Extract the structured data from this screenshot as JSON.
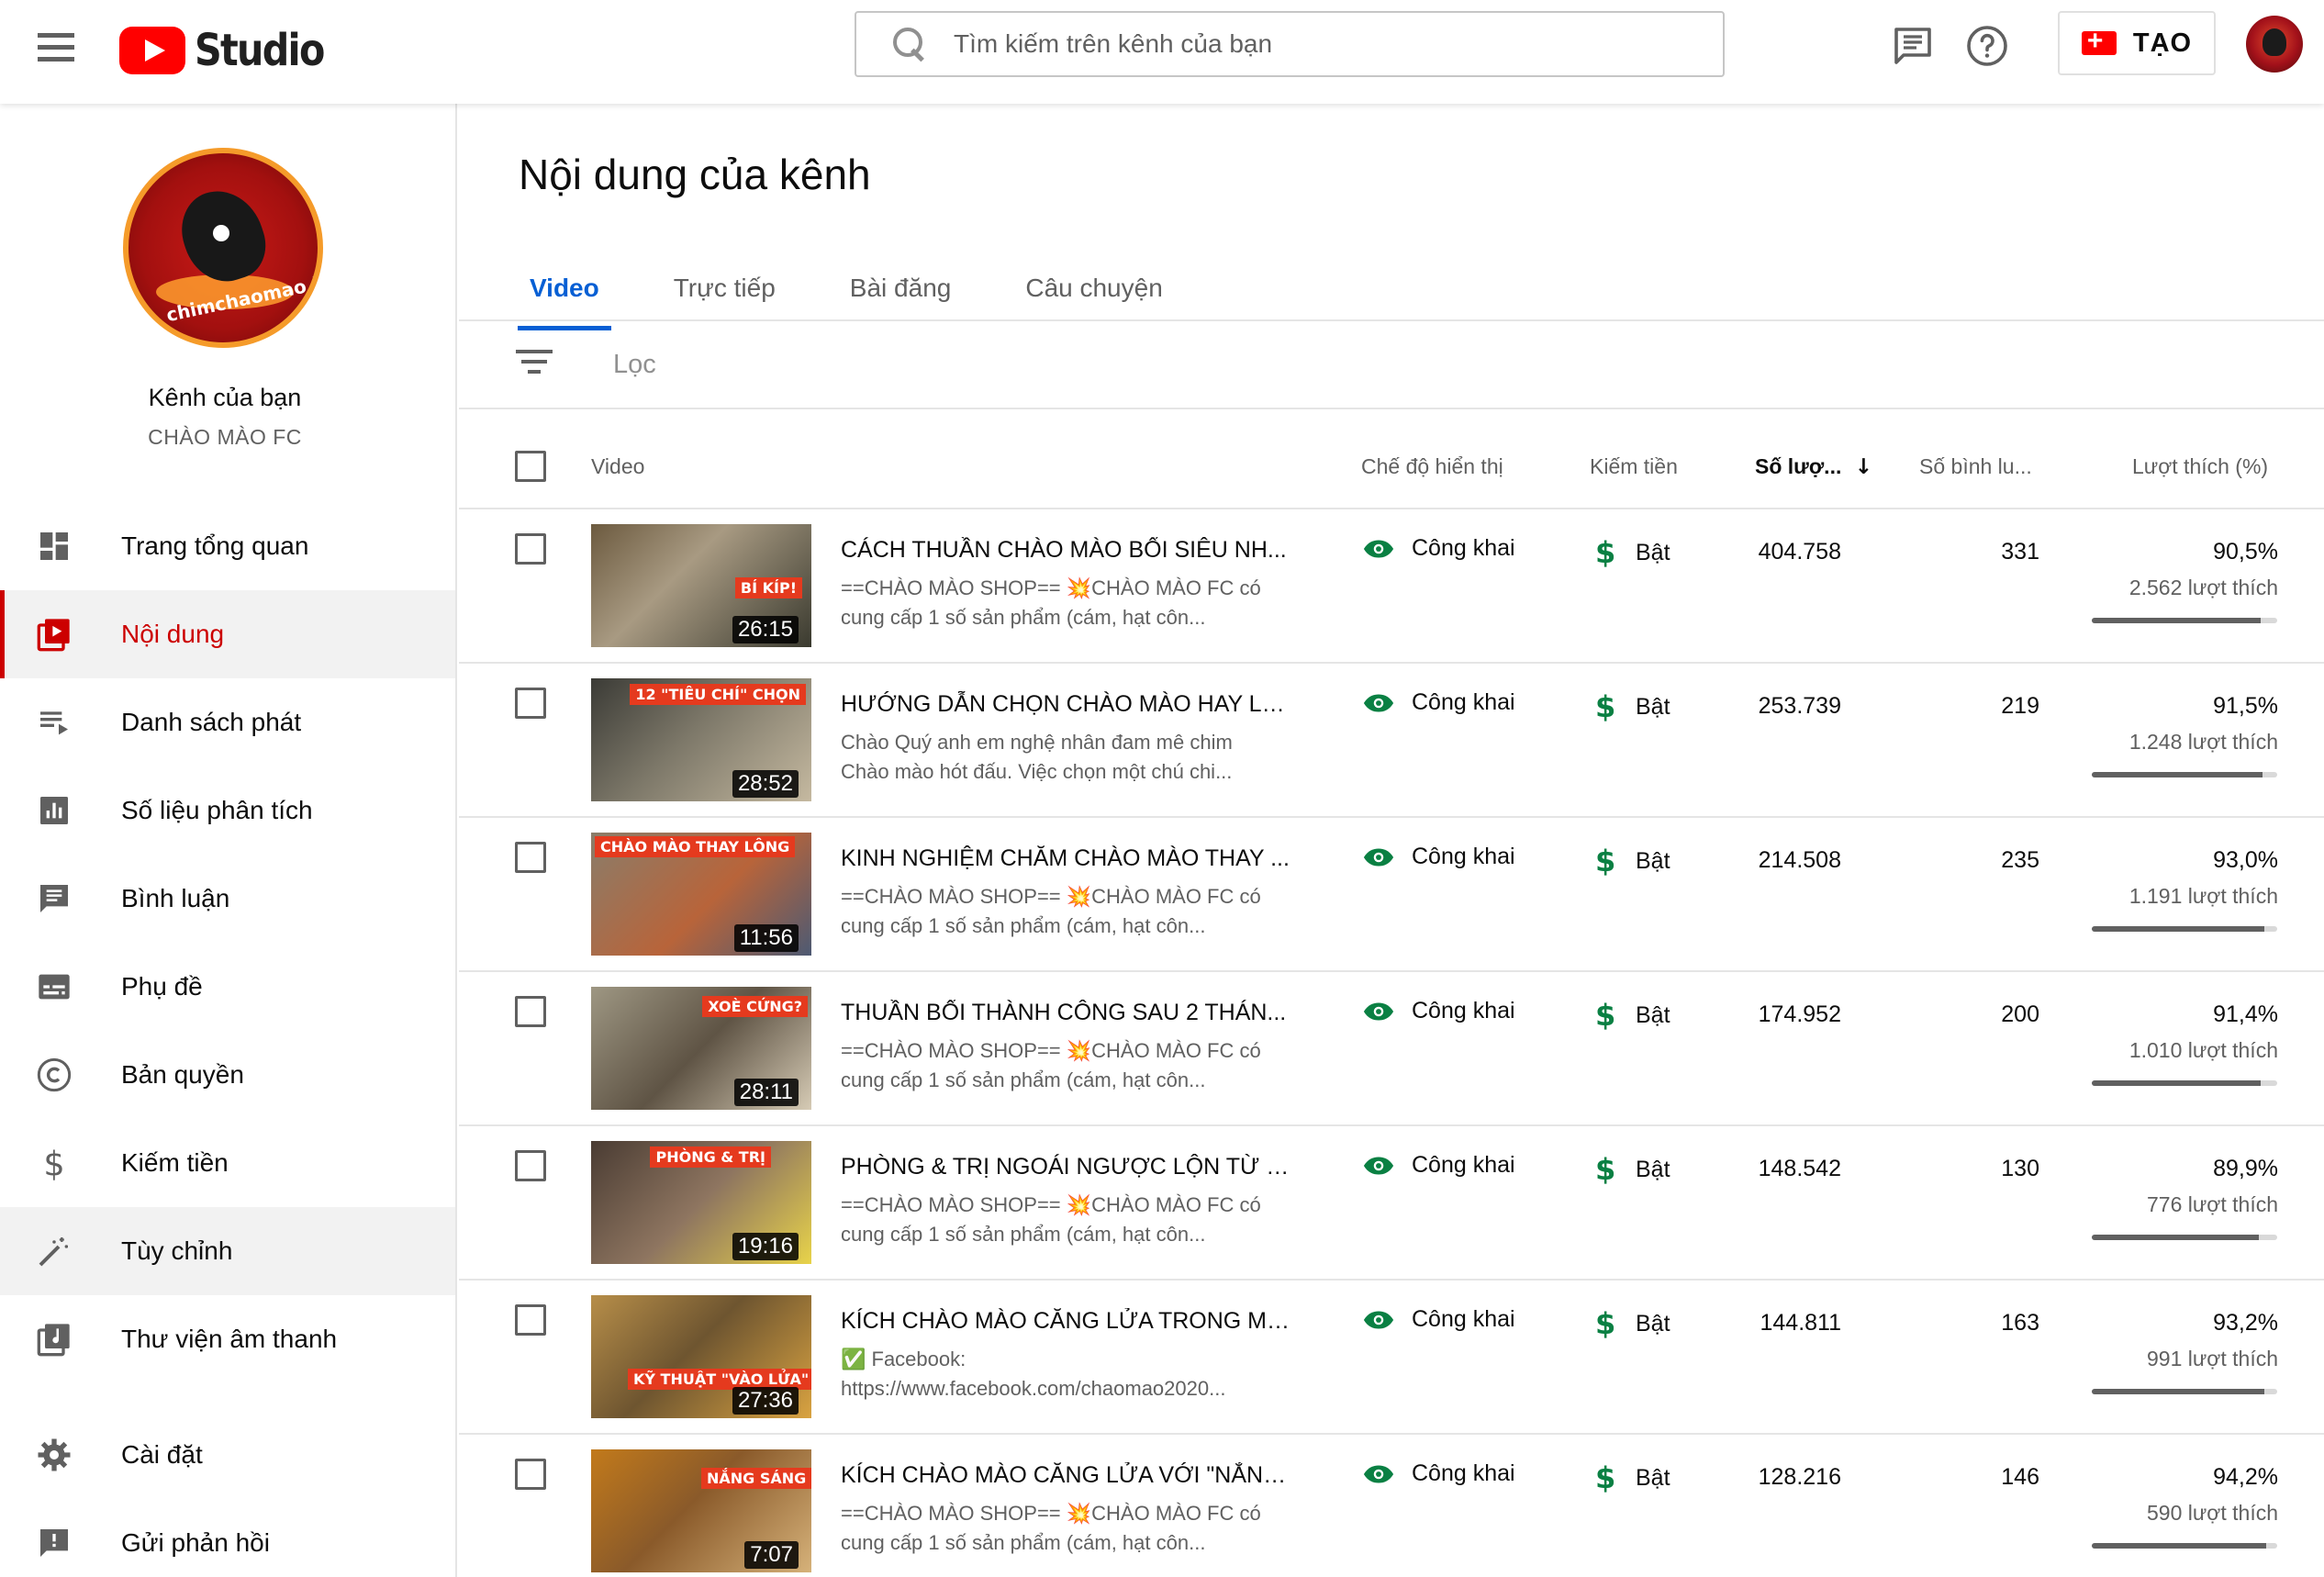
{
  "header": {
    "logo_text": "Studio",
    "search_placeholder": "Tìm kiếm trên kênh của bạn",
    "create_label": "TẠO",
    "icons": [
      "menu-icon",
      "feedback-icon",
      "help-icon",
      "create-camera-icon",
      "account-avatar"
    ],
    "brand_color": "#ff0000"
  },
  "sidebar": {
    "channel_title": "Kênh của bạn",
    "channel_name": "CHÀO MÀO FC",
    "avatar_text": "chimchaomao.info",
    "items": [
      {
        "label": "Trang tổng quan",
        "icon": "dashboard-icon"
      },
      {
        "label": "Nội dung",
        "icon": "content-icon",
        "active": true
      },
      {
        "label": "Danh sách phát",
        "icon": "playlist-icon"
      },
      {
        "label": "Số liệu phân tích",
        "icon": "analytics-icon"
      },
      {
        "label": "Bình luận",
        "icon": "comments-icon"
      },
      {
        "label": "Phụ đề",
        "icon": "subtitles-icon"
      },
      {
        "label": "Bản quyền",
        "icon": "copyright-icon"
      },
      {
        "label": "Kiếm tiền",
        "icon": "monetization-icon"
      },
      {
        "label": "Tùy chỉnh",
        "icon": "customization-icon"
      },
      {
        "label": "Thư viện âm thanh",
        "icon": "audio-library-icon"
      },
      {
        "label": "Cài đặt",
        "icon": "settings-icon"
      },
      {
        "label": "Gửi phản hồi",
        "icon": "send-feedback-icon"
      }
    ],
    "active_color": "#cc0000"
  },
  "main": {
    "title": "Nội dung của kênh",
    "tabs": [
      {
        "label": "Video",
        "active": true
      },
      {
        "label": "Trực tiếp"
      },
      {
        "label": "Bài đăng"
      },
      {
        "label": "Câu chuyện"
      }
    ],
    "filter_label": "Lọc",
    "columns": {
      "video": "Video",
      "visibility": "Chế độ hiển thị",
      "monetization": "Kiếm tiền",
      "views": "Số lượ...",
      "comments": "Số bình lu...",
      "likes": "Lượt thích (%)"
    },
    "accent_color": "#065fd4",
    "videos": [
      {
        "title": "CÁCH THUẦN CHÀO MÀO BỔI SIÊU NH...",
        "desc1": "==CHÀO MÀO SHOP== 💥CHÀO MÀO FC có",
        "desc2": "cung cấp 1 số sản phẩm (cám, hạt côn...",
        "duration": "26:15",
        "thumb_caption": "BÍ KÍP!",
        "visibility": "Công khai",
        "monetization": "Bật",
        "views": "404.758",
        "comments": "331",
        "likes_pct": "90,5%",
        "likes_count": "2.562 lượt thích",
        "likes_ratio": 0.905
      },
      {
        "title": "HƯỚNG DẪN CHỌN CHÀO MÀO HAY LU...",
        "desc1": "Chào Quý anh em nghệ nhân đam mê chim",
        "desc2": "Chào mào hót đấu. Việc chọn một chú chi...",
        "duration": "28:52",
        "thumb_caption": "12 \"TIÊU CHÍ\" CHỌN",
        "visibility": "Công khai",
        "monetization": "Bật",
        "views": "253.739",
        "comments": "219",
        "likes_pct": "91,5%",
        "likes_count": "1.248 lượt thích",
        "likes_ratio": 0.915
      },
      {
        "title": "KINH NGHIỆM CHĂM CHÀO MÀO THAY ...",
        "desc1": "==CHÀO MÀO SHOP== 💥CHÀO MÀO FC có",
        "desc2": "cung cấp 1 số sản phẩm (cám, hạt côn...",
        "duration": "11:56",
        "thumb_caption": "CHÀO MÀO THAY LÔNG",
        "visibility": "Công khai",
        "monetization": "Bật",
        "views": "214.508",
        "comments": "235",
        "likes_pct": "93,0%",
        "likes_count": "1.191 lượt thích",
        "likes_ratio": 0.93
      },
      {
        "title": "THUẦN BỔI THÀNH CÔNG SAU 2 THÁN...",
        "desc1": "==CHÀO MÀO SHOP== 💥CHÀO MÀO FC có",
        "desc2": "cung cấp 1 số sản phẩm (cám, hạt côn...",
        "duration": "28:11",
        "thumb_caption": "XOÈ CỨNG?",
        "visibility": "Công khai",
        "monetization": "Bật",
        "views": "174.952",
        "comments": "200",
        "likes_pct": "91,4%",
        "likes_count": "1.010 lượt thích",
        "likes_ratio": 0.914
      },
      {
        "title": "PHÒNG & TRỊ NGOÁI NGƯỢC LỘN TỪ 2 ...",
        "desc1": "==CHÀO MÀO SHOP== 💥CHÀO MÀO FC có",
        "desc2": "cung cấp 1 số sản phẩm (cám, hạt côn...",
        "duration": "19:16",
        "thumb_caption": "PHÒNG & TRỊ",
        "visibility": "Công khai",
        "monetization": "Bật",
        "views": "148.542",
        "comments": "130",
        "likes_pct": "89,9%",
        "likes_count": "776 lượt thích",
        "likes_ratio": 0.899
      },
      {
        "title": "KÍCH CHÀO MÀO CĂNG LỬA TRONG MỘ...",
        "desc1": "✅ Facebook:",
        "desc2": "https://www.facebook.com/chaomao2020...",
        "duration": "27:36",
        "thumb_caption": "KỸ THUẬT \"VÀO LỬA\"",
        "visibility": "Công khai",
        "monetization": "Bật",
        "views": "144.811",
        "comments": "163",
        "likes_pct": "93,2%",
        "likes_count": "991 lượt thích",
        "likes_ratio": 0.932
      },
      {
        "title": "KÍCH CHÀO MÀO CĂNG LỬA VỚI \"NẮNG...",
        "desc1": "==CHÀO MÀO SHOP== 💥CHÀO MÀO FC có",
        "desc2": "cung cấp 1 số sản phẩm (cám, hạt côn...",
        "duration": "7:07",
        "thumb_caption": "NẮNG SÁNG vs NẮNG CHIỀU",
        "visibility": "Công khai",
        "monetization": "Bật",
        "views": "128.216",
        "comments": "146",
        "likes_pct": "94,2%",
        "likes_count": "590 lượt thích",
        "likes_ratio": 0.942
      }
    ]
  }
}
